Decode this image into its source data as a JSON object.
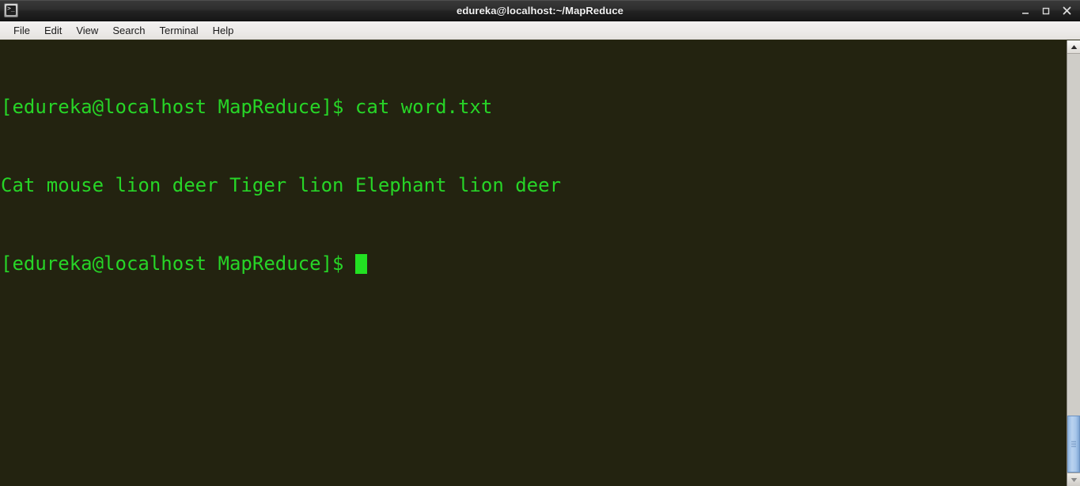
{
  "window": {
    "title": "edureka@localhost:~/MapReduce",
    "icon": "terminal-icon",
    "controls": {
      "minimize_label": "–",
      "maximize_label": "□",
      "close_label": "✕"
    }
  },
  "menubar": {
    "items": [
      {
        "label": "File"
      },
      {
        "label": "Edit"
      },
      {
        "label": "View"
      },
      {
        "label": "Search"
      },
      {
        "label": "Terminal"
      },
      {
        "label": "Help"
      }
    ]
  },
  "terminal": {
    "background_color": "#232310",
    "text_color": "#27d527",
    "cursor_color": "#22e022",
    "lines": [
      "[edureka@localhost MapReduce]$ cat word.txt",
      "Cat mouse lion deer Tiger lion Elephant lion deer",
      "[edureka@localhost MapReduce]$ "
    ],
    "prompt": "[edureka@localhost MapReduce]$",
    "command": "cat word.txt",
    "output": "Cat mouse lion deer Tiger lion Elephant lion deer"
  },
  "scrollbar": {
    "up_arrow": "scroll-up-arrow",
    "down_arrow": "scroll-down-arrow",
    "thumb_position": "bottom"
  }
}
